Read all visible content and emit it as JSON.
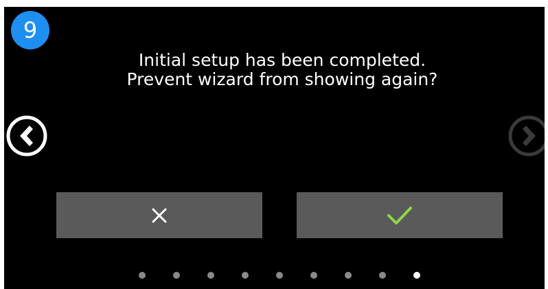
{
  "step": {
    "number": "9",
    "color": "#1e8ff0"
  },
  "message": {
    "line1": "Initial setup has been completed.",
    "line2": "Prevent wizard from showing again?"
  },
  "nav": {
    "prev_icon": "chevron-left-circle-icon",
    "next_icon": "chevron-right-circle-icon",
    "next_enabled": false
  },
  "buttons": {
    "cancel_icon": "x-icon",
    "confirm_icon": "checkmark-icon",
    "confirm_color": "#8fd64a",
    "background": "#5a5a5a"
  },
  "pagination": {
    "total": 9,
    "current": 9
  }
}
